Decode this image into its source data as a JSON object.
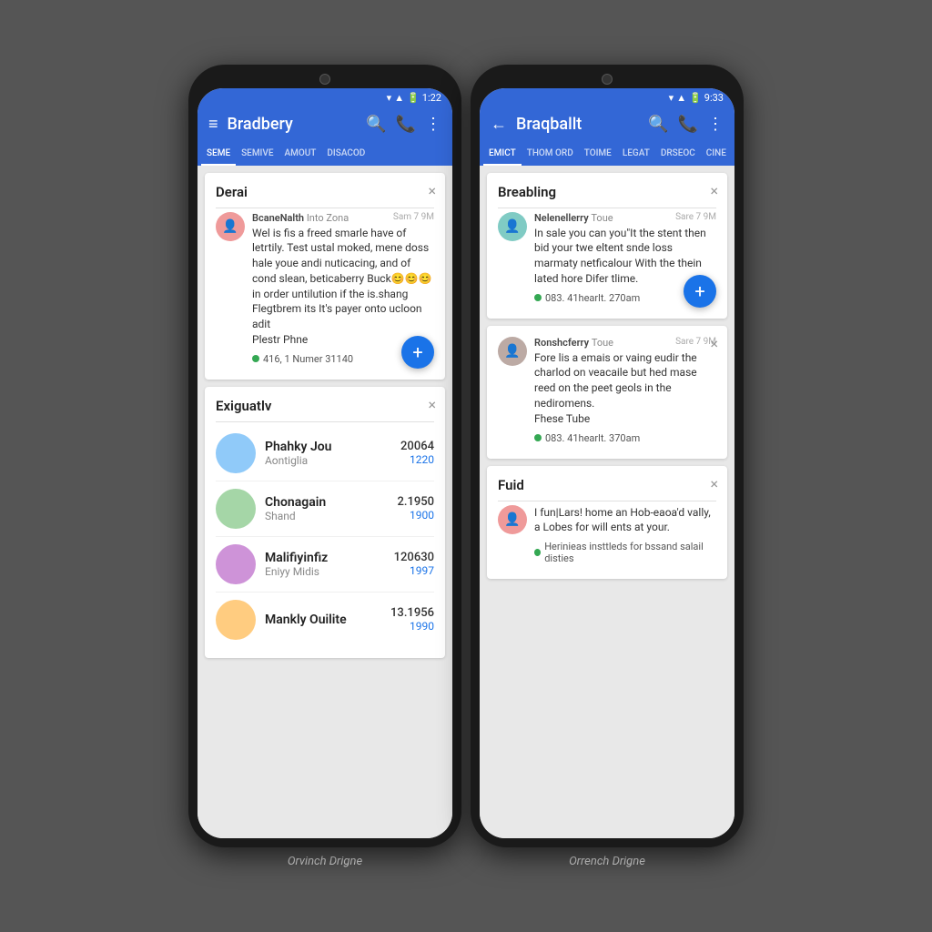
{
  "phones": [
    {
      "id": "phone1",
      "label": "Orvinch Drigne",
      "time": "1:22",
      "appbar": {
        "menu_icon": "≡",
        "title": "Bradbery",
        "search_icon": "🔍",
        "call_icon": "📞",
        "more_icon": "⋮"
      },
      "tabs": [
        {
          "label": "SEME",
          "active": true
        },
        {
          "label": "SEMIVE",
          "active": false
        },
        {
          "label": "AMOUT",
          "active": false
        },
        {
          "label": "DISACOD",
          "active": false
        }
      ],
      "cards": [
        {
          "id": "card1",
          "title": "Derai",
          "type": "message",
          "avatar_color": "av1",
          "sender": "BcaneNalth",
          "sender_sub": "Into Zona",
          "time": "Sam 7 9M",
          "text": "Wel is fis a freed smarle have of letrtily. Test ustal moked, mene doss hale youe andi nuticacing, and of cond slean, beticaberry Buck😊😊😊 in order untilution if the is.shang Flegtbrem its It's payer onto ucloon adit",
          "link": "Plestr Phne",
          "meta": "416, 1 Numer 31140",
          "has_fab": true
        },
        {
          "id": "card2",
          "title": "Exiguatlv",
          "type": "list",
          "items": [
            {
              "name": "Phahky Jou",
              "sub": "Aontiglia",
              "num1": "20064",
              "num2": "1220",
              "av": "av2"
            },
            {
              "name": "Chonagain",
              "sub": "Shand",
              "num1": "2.1950",
              "num2": "1900",
              "av": "av3"
            },
            {
              "name": "Malifiyinfiz",
              "sub": "Eniyy Midis",
              "num1": "120630",
              "num2": "1997",
              "av": "av4"
            },
            {
              "name": "Mankly Ouilite",
              "sub": "",
              "num1": "13.1956",
              "num2": "1990",
              "av": "av5"
            }
          ]
        }
      ]
    },
    {
      "id": "phone2",
      "label": "Orrench Drigne",
      "time": "9:33",
      "appbar": {
        "back_icon": "←",
        "title": "Braqballt",
        "search_icon": "🔍",
        "call_icon": "📞",
        "more_icon": "⋮"
      },
      "tabs": [
        {
          "label": "EMICT",
          "active": true
        },
        {
          "label": "THOM ORD",
          "active": false
        },
        {
          "label": "TOIME",
          "active": false
        },
        {
          "label": "LEGAT",
          "active": false
        },
        {
          "label": "DRSEOC",
          "active": false
        },
        {
          "label": "CINE",
          "active": false
        }
      ],
      "cards": [
        {
          "id": "card3",
          "title": "Breabling",
          "type": "message",
          "avatar_color": "av6",
          "sender": "Nelenellerry",
          "sender_sub": "Toue",
          "time": "Sare 7 9M",
          "text": "In sale you can you\"It the stent then bid your twe eltent snde loss marmaty netficalour With the thein lated hore Difer tlime.",
          "link": null,
          "meta": "083. 41hearlt. 270am",
          "has_fab": true
        },
        {
          "id": "card4",
          "title": "",
          "type": "message",
          "avatar_color": "av7",
          "sender": "Ronshcferry",
          "sender_sub": "Toue",
          "time": "Sare 7 9M",
          "text": "Fore lis a emais or vaing eudir the charlod on veacaile but hed mase reed on the peet geols in the nediromens.",
          "link": "Fhese Tube",
          "meta": "083. 41hearlt. 370am",
          "has_fab": false
        },
        {
          "id": "card5",
          "title": "Fuid",
          "type": "message",
          "avatar_color": "av1",
          "sender": "",
          "sender_sub": "",
          "time": "",
          "text": "I fun|Lars! home an Hob-eaoa'd vally, a Lobes for will ents at your.",
          "link": null,
          "meta": "Herinieas insttleds for bssand salail disties",
          "has_fab": false
        }
      ]
    }
  ]
}
